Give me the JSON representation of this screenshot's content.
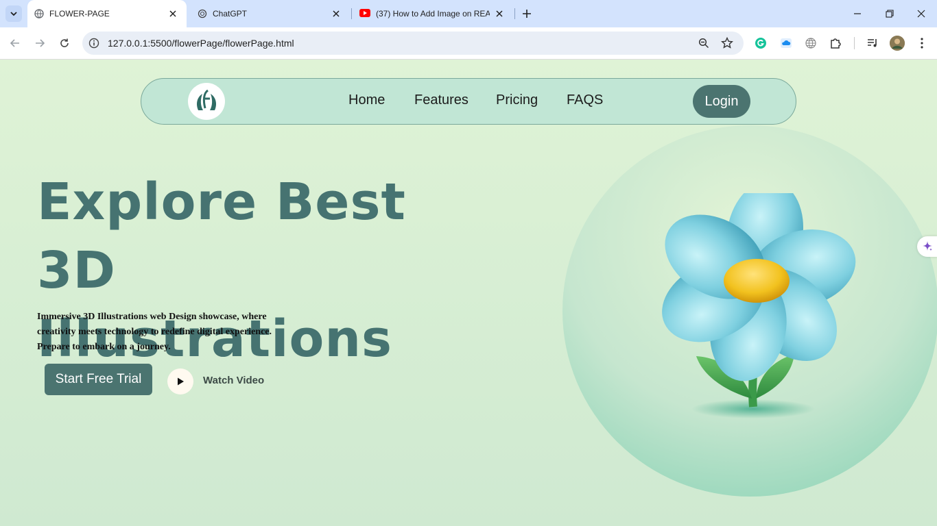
{
  "browser": {
    "tabs": [
      {
        "title": "FLOWER-PAGE",
        "icon": "globe-icon",
        "active": true
      },
      {
        "title": "ChatGPT",
        "icon": "chatgpt-icon",
        "active": false
      },
      {
        "title": "(37) How to Add Image on REA",
        "icon": "youtube-icon",
        "active": false
      }
    ],
    "url": "127.0.0.1:5500/flowerPage/flowerPage.html"
  },
  "site": {
    "nav": {
      "links": [
        "Home",
        "Features",
        "Pricing",
        "FAQS"
      ],
      "login": "Login"
    },
    "hero": {
      "title_line1": "Explore Best 3D",
      "title_line2": "Illustrations",
      "subtitle": "Immersive 3D Illustrations web Design showcase, where creativity meets technology to redefine digital experience. Prepare to embark on a journey.",
      "cta": "Start Free Trial",
      "watch": "Watch Video"
    }
  },
  "colors": {
    "accent": "#4b7470",
    "title": "#467371",
    "petal": "#7fd0e0",
    "center": "#f2c21f"
  }
}
